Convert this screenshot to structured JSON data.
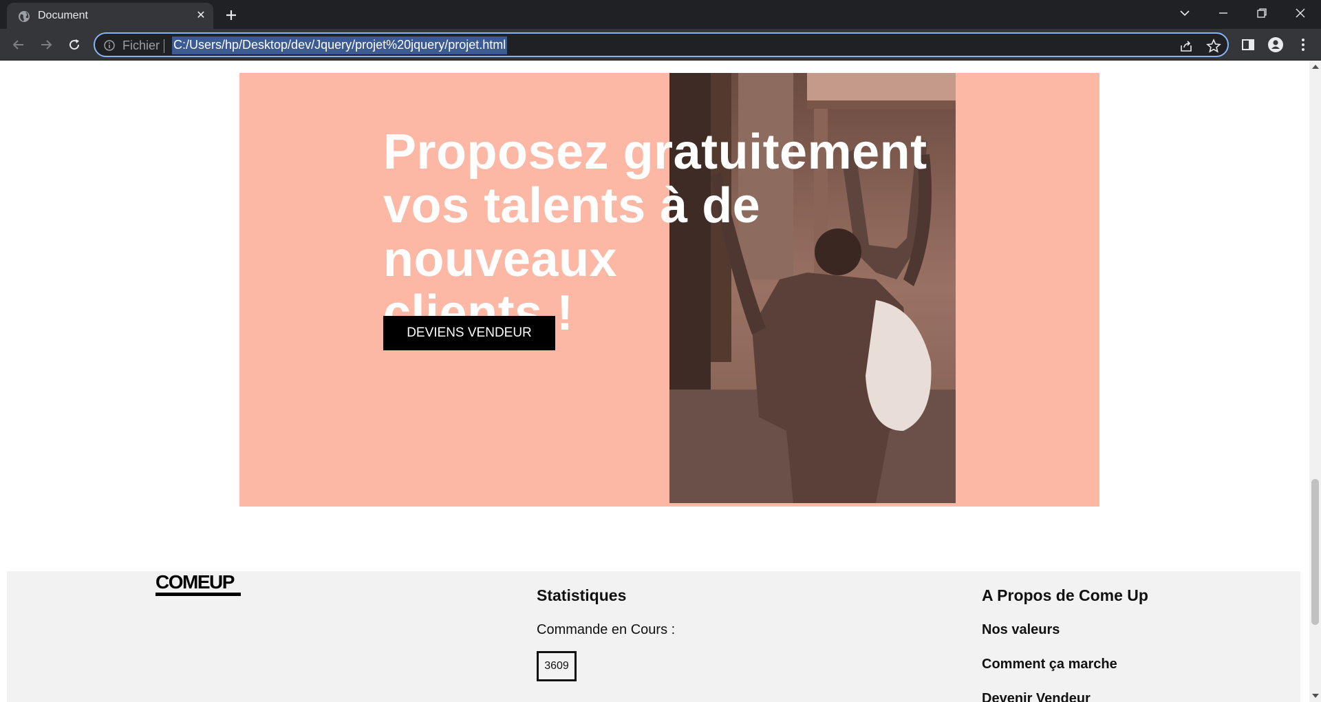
{
  "browser": {
    "tab_title": "Document",
    "scheme_label": "Fichier",
    "url": "C:/Users/hp/Desktop/dev/Jquery/projet%20jquery/projet.html"
  },
  "hero": {
    "headline_line1": "Proposez gratuitement",
    "headline_line2": "vos talents à de nouveaux",
    "headline_line3": "clients !",
    "cta_label": "DEVIENS VENDEUR",
    "background_color": "#fcb8a4"
  },
  "footer": {
    "logo_text": "COMEUP",
    "stats_title": "Statistiques",
    "stats_label": "Commande en Cours :",
    "stats_value": "3609",
    "about_title": "A Propos de Come Up",
    "about_links": [
      "Nos valeurs",
      "Comment ça marche",
      "Devenir Vendeur"
    ]
  }
}
